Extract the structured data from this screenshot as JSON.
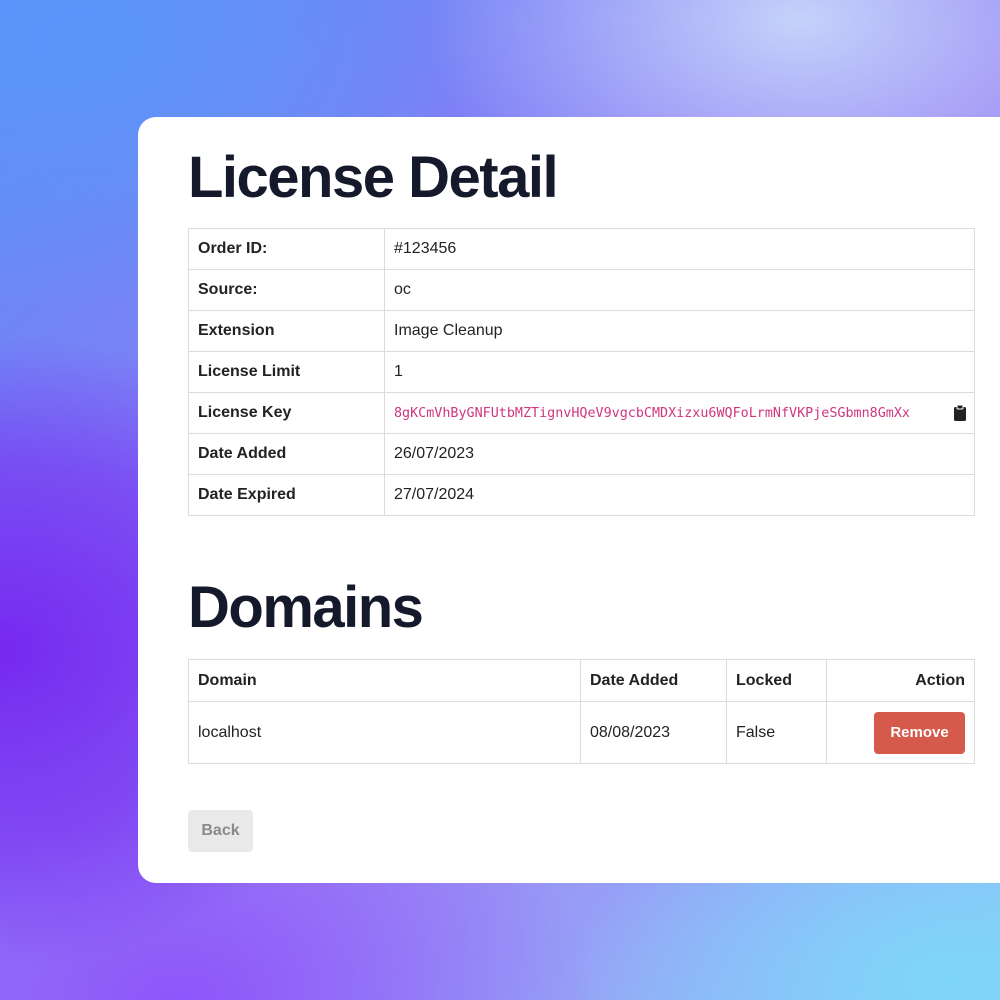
{
  "license_detail": {
    "title": "License Detail",
    "rows": [
      {
        "label": "Order ID:",
        "value": "#123456"
      },
      {
        "label": "Source:",
        "value": "oc"
      },
      {
        "label": "Extension",
        "value": "Image Cleanup"
      },
      {
        "label": "License Limit",
        "value": "1"
      },
      {
        "label": "License Key",
        "value": "8gKCmVhByGNFUtbMZTignvHQeV9vgcbCMDXizxu6WQFoLrmNfVKPjeSGbmn8GmXx"
      },
      {
        "label": "Date Added",
        "value": "26/07/2023"
      },
      {
        "label": "Date Expired",
        "value": "27/07/2024"
      }
    ],
    "license_key_color": "#d0367f",
    "copy_icon": "clipboard-icon"
  },
  "domains": {
    "title": "Domains",
    "headers": {
      "domain": "Domain",
      "date_added": "Date Added",
      "locked": "Locked",
      "action": "Action"
    },
    "rows": [
      {
        "domain": "localhost",
        "date_added": "08/08/2023",
        "locked": "False",
        "action_label": "Remove"
      }
    ],
    "remove_button_color": "#d65a4c"
  },
  "footer": {
    "back_label": "Back"
  }
}
